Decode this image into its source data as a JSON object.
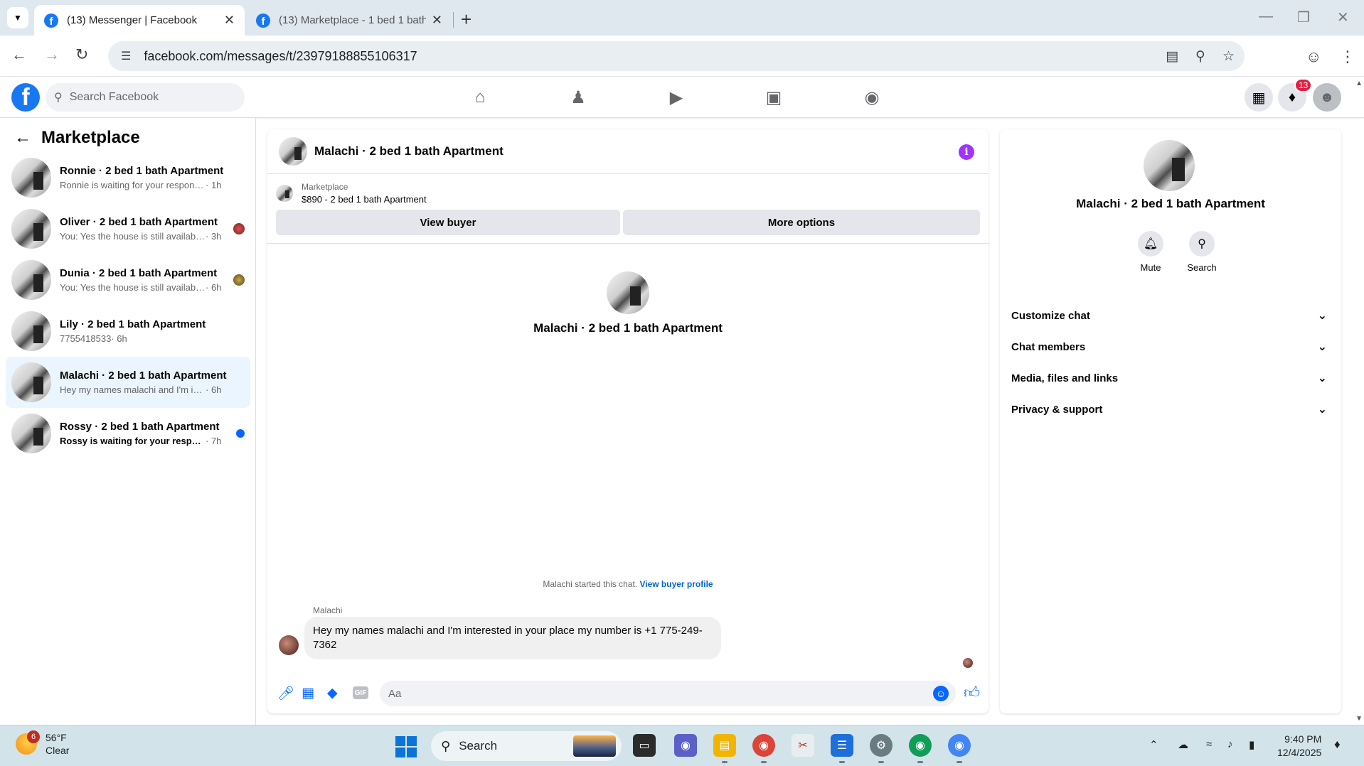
{
  "browser": {
    "tabs": [
      {
        "title": "(13) Messenger | Facebook",
        "active": true
      },
      {
        "title": "(13) Marketplace - 1 bed 1 bath",
        "active": false
      }
    ],
    "url": "facebook.com/messages/t/23979188855106317"
  },
  "fb": {
    "search_placeholder": "Search Facebook",
    "notification_count": "13"
  },
  "sidebar": {
    "title": "Marketplace",
    "conversations": [
      {
        "name": "Ronnie · 2 bed 1 bath Apartment",
        "preview": "Ronnie is waiting for your response.",
        "time": " · 1h",
        "bold": false
      },
      {
        "name": "Oliver · 2 bed 1 bath Apartment",
        "preview": "You: Yes the house is still available ...",
        "time": " · 3h",
        "bold": false
      },
      {
        "name": "Dunia · 2 bed 1 bath Apartment",
        "preview": "You: Yes the house is still available ...",
        "time": " · 6h",
        "bold": false
      },
      {
        "name": "Lily · 2 bed 1 bath Apartment",
        "preview": "7755418533",
        "time": " · 6h",
        "bold": false
      },
      {
        "name": "Malachi · 2 bed 1 bath Apartment",
        "preview": "Hey my names malachi and I'm intere...",
        "time": " · 6h",
        "bold": false
      },
      {
        "name": "Rossy · 2 bed 1 bath Apartment",
        "preview": "Rossy is waiting for your response.",
        "time": " · 7h",
        "bold": true
      }
    ]
  },
  "chat": {
    "title": "Malachi · 2 bed 1 bath Apartment",
    "marketplace_label": "Marketplace",
    "listing": "$890 - 2 bed 1 bath Apartment",
    "view_buyer": "View buyer",
    "more_options": "More options",
    "center_name": "Malachi · 2 bed 1 bath Apartment",
    "started_text": "Malachi started this chat. ",
    "view_profile": "View buyer profile",
    "sender": "Malachi",
    "message": "Hey my names malachi and I'm interested in your place my number is +1 775-249-7362",
    "gif_label": "GIF",
    "input_placeholder": "Aa"
  },
  "details": {
    "name": "Malachi · 2 bed 1 bath Apartment",
    "actions": [
      "Mute",
      "Search"
    ],
    "sections": [
      "Customize chat",
      "Chat members",
      "Media, files and links",
      "Privacy & support"
    ]
  },
  "taskbar": {
    "weather_badge": "6",
    "temperature": "56°F",
    "condition": "Clear",
    "search": "Search",
    "time": "9:40 PM",
    "date": "12/4/2025"
  },
  "colors": {
    "fb_blue": "#1877f2",
    "messenger_blue": "#0866ff",
    "info_purple": "#a033ff",
    "active_row": "#ebf5ff",
    "badge_red": "#e41e3f"
  }
}
